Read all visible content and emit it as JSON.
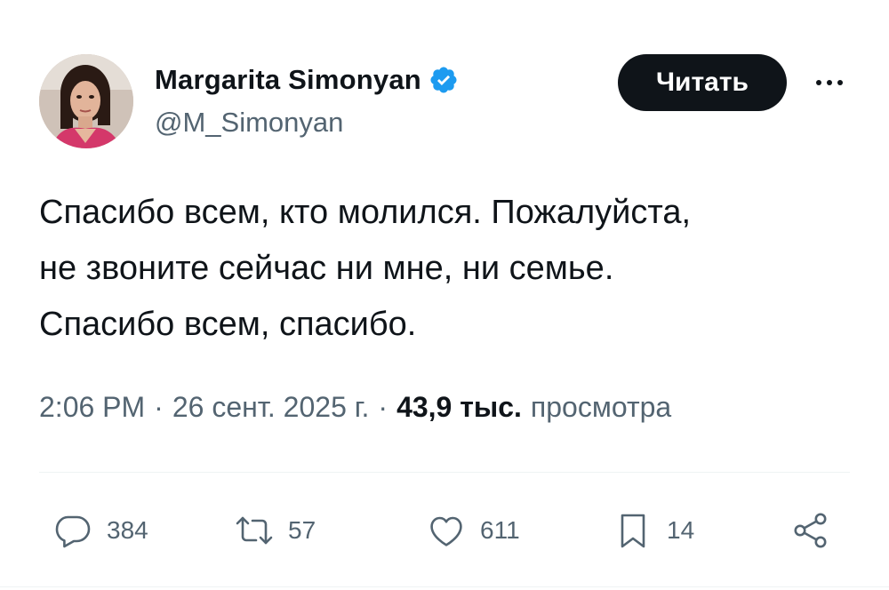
{
  "author": {
    "display_name": "Margarita Simonyan",
    "handle": "@M_Simonyan",
    "verified_icon": "verified-badge-icon",
    "avatar_label": "profile photo"
  },
  "header": {
    "follow_label": "Читать",
    "more_icon": "more-horizontal-icon"
  },
  "tweet": {
    "lines": [
      "Спасибо всем, кто молился. Пожалуйста,",
      "не звоните сейчас ни мне, ни семье.",
      "Спасибо всем, спасибо."
    ]
  },
  "meta": {
    "time": "2:06 PM",
    "separator": "·",
    "date": "26 сент. 2025 г.",
    "views_count": "43,9 тыс.",
    "views_label": "просмотра"
  },
  "actions": {
    "replies": "384",
    "retweets": "57",
    "likes": "611",
    "bookmarks": "14"
  },
  "colors": {
    "text": "#0f1419",
    "secondary": "#536471",
    "verified": "#1d9bf0",
    "divider": "#eff3f4",
    "button_bg": "#0f1419"
  }
}
